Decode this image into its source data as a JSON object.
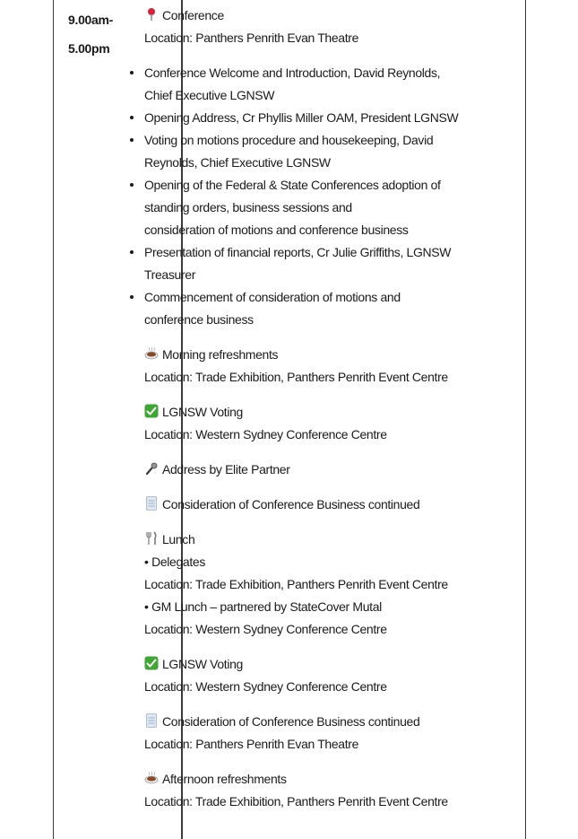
{
  "time": {
    "line1": "9.00am-",
    "line2": "5.00pm"
  },
  "conference": {
    "title": "Conference",
    "location": "Location: Panthers Penrith Evan Theatre"
  },
  "agenda_items": [
    "Conference Welcome and Introduction, David Reynolds, Chief Executive LGNSW",
    "Opening Address, Cr Phyllis Miller OAM, President LGNSW",
    "Voting on motions procedure and housekeeping, David Reynolds, Chief Executive LGNSW",
    "Opening of the Federal & State Conferences adoption of standing orders, business sessions and consideration of motions and conference business",
    "Presentation of financial reports, Cr Julie Griffiths, LGNSW Treasurer",
    "Commencement of consideration of motions and conference business"
  ],
  "agenda_item_3_parts": [
    "Opening of the Federal & State Conferences adoption of standing orders, business sessions and",
    "consideration of motions and conference business"
  ],
  "morning_refreshments": {
    "title": "Morning refreshments",
    "location": "Location: Trade Exhibition, Panthers Penrith Event Centre"
  },
  "voting_1": {
    "title": "LGNSW Voting",
    "location": "Location: Western Sydney Conference Centre"
  },
  "elite_partner": {
    "title": "Address by Elite Partner"
  },
  "business_1": {
    "title": "Consideration of Conference Business continued"
  },
  "lunch": {
    "title": "Lunch",
    "delegates": "• Delegates",
    "delegates_location": "Location: Trade Exhibition, Panthers Penrith Event Centre",
    "gm": "• GM Lunch – partnered by StateCover Mutal",
    "gm_location": "Location: Western Sydney Conference Centre"
  },
  "voting_2": {
    "title": "LGNSW Voting",
    "location": "Location: Western Sydney Conference Centre"
  },
  "business_2": {
    "title": "Consideration of Conference Business continued",
    "location": "Location: Panthers Penrith Evan Theatre"
  },
  "afternoon_refreshments": {
    "title": "Afternoon refreshments",
    "location": "Location: Trade Exhibition, Panthers Penrith Event Centre"
  },
  "icons": {
    "conference": "pin-icon",
    "morning_refreshments": "coffee-icon",
    "voting_1": "check-icon",
    "elite_partner": "microphone-icon",
    "business_1": "document-icon",
    "lunch": "cutlery-icon",
    "voting_2": "check-icon",
    "business_2": "document-icon",
    "afternoon_refreshments": "coffee-icon"
  },
  "colors": {
    "pin": "#d8233a",
    "check": "#3fa535",
    "coffee": "#8a4a2a",
    "document": "#9eb3c9",
    "border": "#3a3a3a"
  }
}
